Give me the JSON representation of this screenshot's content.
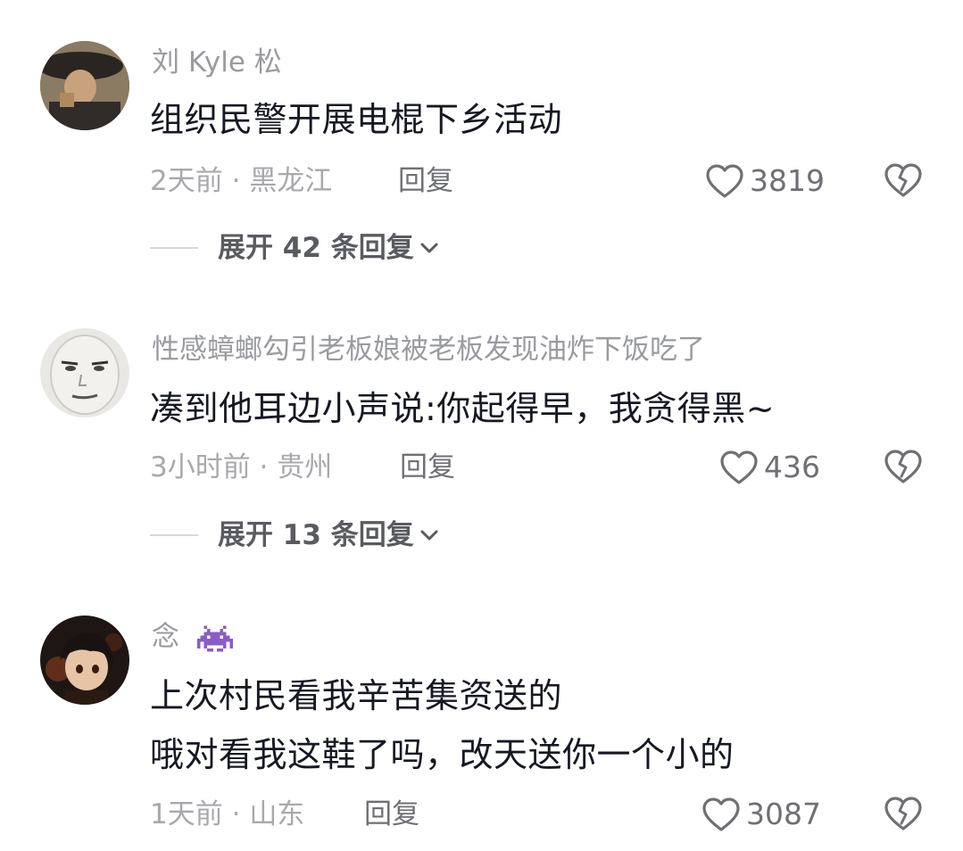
{
  "comments": [
    {
      "username": "刘 Kyle 松",
      "lines": [
        "组织民警开展电棍下乡活动"
      ],
      "time": "2天前",
      "separator": "·",
      "location": "黑龙江",
      "reply_label": "回复",
      "likes": "3819",
      "expand_label": "展开 42 条回复",
      "avatar_icon": "avatar-man-hat"
    },
    {
      "username": "性感蟑螂勾引老板娘被老板发现油炸下饭吃了",
      "lines": [
        "凑到他耳边小声说:你起得早，我贪得黑~"
      ],
      "time": "3小时前",
      "separator": "·",
      "location": "贵州",
      "reply_label": "回复",
      "likes": "436",
      "expand_label": "展开 13 条回复",
      "avatar_icon": "avatar-face-meme"
    },
    {
      "username": "念",
      "username_badge_icon": "space-invader-icon",
      "lines": [
        "上次村民看我辛苦集资送的",
        "哦对看我这鞋了吗，改天送你一个小的"
      ],
      "time": "1天前",
      "separator": "·",
      "location": "山东",
      "reply_label": "回复",
      "likes": "3087",
      "avatar_icon": "avatar-anime-boy"
    }
  ],
  "icons": {
    "like": "heart-outline-icon",
    "dislike": "broken-heart-icon",
    "expand": "chevron-down-icon"
  },
  "colors": {
    "primary_text": "#161823",
    "secondary_text": "#a8a9ad",
    "action_text": "#6f7075",
    "badge_purple": "#8a5cc8"
  }
}
